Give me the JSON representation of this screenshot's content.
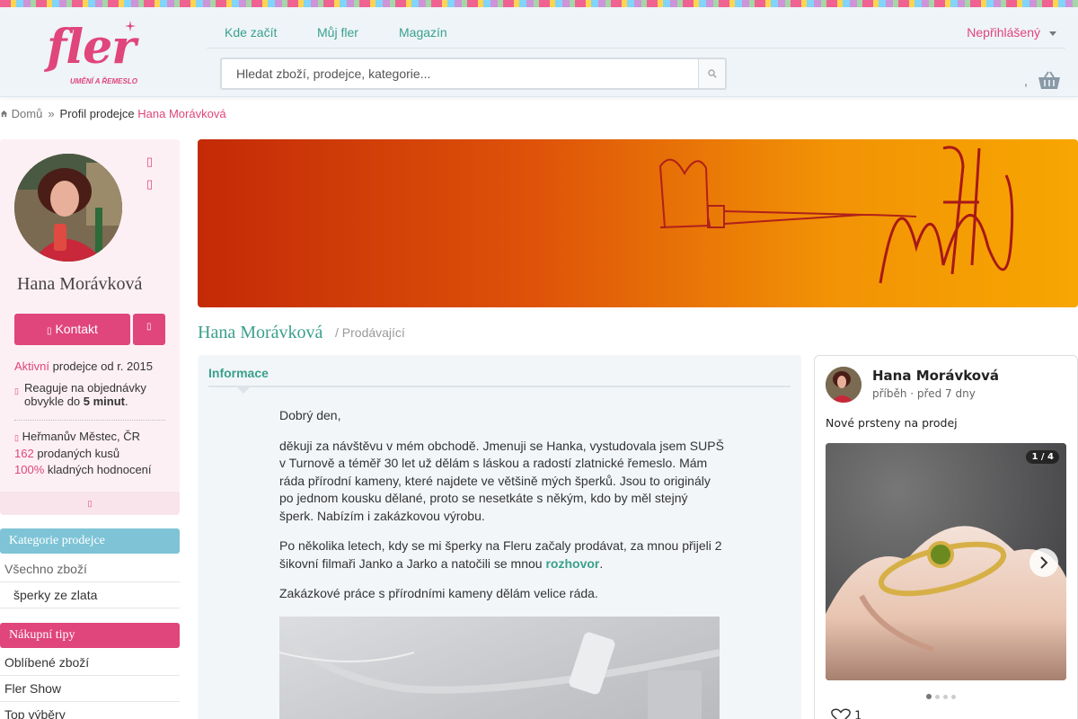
{
  "header": {
    "logo_text": "fler",
    "logo_tagline": "UMĚNÍ A ŘEMESLO",
    "nav": [
      "Kde začít",
      "Můj fler",
      "Magazín"
    ],
    "user_status": "Nepřihlášený",
    "search_placeholder": "Hledat zboží, prodejce, kategorie...",
    "cart_separator": ","
  },
  "breadcrumb": {
    "home": "Domů",
    "separator": "»",
    "current_prefix": "Profil prodejce",
    "seller": "Hana Morávková"
  },
  "profile": {
    "name": "Hana Morávková",
    "contact_label": "Kontakt",
    "status_active": "Aktivní",
    "status_since": "prodejce od r. 2015",
    "response_text": "Reaguje na objednávky obvykle do",
    "response_time": "5 minut",
    "location": "Heřmanův Městec, ČR",
    "sold_count": "162",
    "sold_label": "prodaných kusů",
    "rating_pct": "100%",
    "rating_label": "kladných hodnocení"
  },
  "sidebar": {
    "categories_title": "Kategorie prodejce",
    "categories": [
      "Všechno zboží",
      "šperky ze zlata"
    ],
    "tips_title": "Nákupní tipy",
    "tips": [
      "Oblíbené zboží",
      "Fler Show",
      "Top výběry"
    ]
  },
  "shop": {
    "title": "Hana Morávková",
    "role": "/ Prodávající"
  },
  "info": {
    "tab_label": "Informace",
    "greeting": "Dobrý den,",
    "para1": "děkuji za návštěvu v mém obchodě. Jmenuji se Hanka, vystudovala jsem SUPŠ v Turnově a téměř 30 let už dělám s láskou a radostí zlatnické řemeslo. Mám ráda přírodní kameny, které najdete ve většině mých šperků. Jsou to originály po jednom kousku dělané, proto se nesetkáte s někým, kdo by měl stejný šperk. Nabízím i zakázkovou výrobu.",
    "para2_before": "Po několika letech, kdy se mi šperky na Fleru začaly prodávat, za mnou přijeli 2 šikovní filmaři Janko a Jarko a natočili se mnou ",
    "para2_link": "rozhovor",
    "para2_after": ".",
    "para3": "Zakázkové práce s přírodními kameny dělám velice ráda."
  },
  "story": {
    "author": "Hana Morávková",
    "meta": "příběh · před 7 dny",
    "text": "Nové prsteny na prodej",
    "counter": "1 / 4",
    "likes": "1",
    "total_slides": 4,
    "active_slide": 1
  },
  "colors": {
    "brand_pink": "#e0457b",
    "teal": "#3aa08c",
    "categories_header": "#7ec4d6",
    "tips_header": "#e0457b"
  }
}
